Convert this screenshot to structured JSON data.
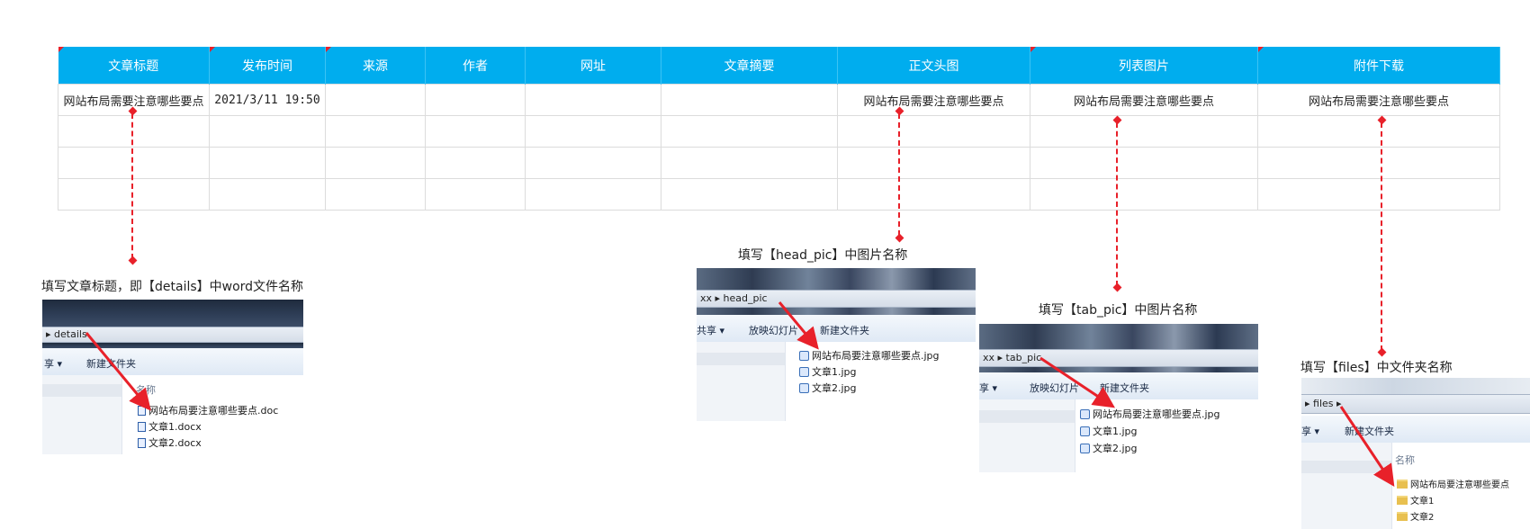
{
  "table": {
    "headers": [
      "文章标题",
      "发布时间",
      "来源",
      "作者",
      "网址",
      "文章摘要",
      "正文头图",
      "列表图片",
      "附件下载"
    ],
    "rows": [
      [
        "网站布局需要注意哪些要点",
        "2021/3/11 19:50",
        "",
        "",
        "",
        "",
        "网站布局需要注意哪些要点",
        "网站布局需要注意哪些要点",
        "网站布局需要注意哪些要点"
      ],
      [
        "",
        "",
        "",
        "",
        "",
        "",
        "",
        "",
        ""
      ],
      [
        "",
        "",
        "",
        "",
        "",
        "",
        "",
        "",
        ""
      ],
      [
        "",
        "",
        "",
        "",
        "",
        "",
        "",
        "",
        ""
      ]
    ]
  },
  "captions": {
    "details": "填写文章标题，即【details】中word文件名称",
    "head_pic": "填写【head_pic】中图片名称",
    "tab_pic": "填写【tab_pic】中图片名称",
    "files": "填写【files】中文件夹名称"
  },
  "explorer_details": {
    "breadcrumb": "details",
    "toolbar": [
      "享 ▾",
      "新建文件夹"
    ],
    "column_header": "名称",
    "items": [
      "网站布局要注意哪些要点.doc",
      "文章1.docx",
      "文章2.docx"
    ]
  },
  "explorer_head_pic": {
    "breadcrumb_prefix": "xx",
    "breadcrumb": "head_pic",
    "toolbar": [
      "共享 ▾",
      "放映幻灯片",
      "新建文件夹"
    ],
    "items": [
      "网站布局要注意哪些要点.jpg",
      "文章1.jpg",
      "文章2.jpg"
    ]
  },
  "explorer_tab_pic": {
    "breadcrumb_prefix": "xx",
    "breadcrumb": "tab_pic",
    "toolbar": [
      "享 ▾",
      "放映幻灯片",
      "新建文件夹"
    ],
    "items": [
      "网站布局要注意哪些要点.jpg",
      "文章1.jpg",
      "文章2.jpg"
    ]
  },
  "explorer_files": {
    "breadcrumb": "files",
    "toolbar": [
      "享 ▾",
      "新建文件夹"
    ],
    "column_header": "名称",
    "items": [
      "网站布局要注意哪些要点",
      "文章1",
      "文章2"
    ]
  },
  "colors": {
    "header_bg": "#00adee",
    "connector": "#e8212a"
  }
}
